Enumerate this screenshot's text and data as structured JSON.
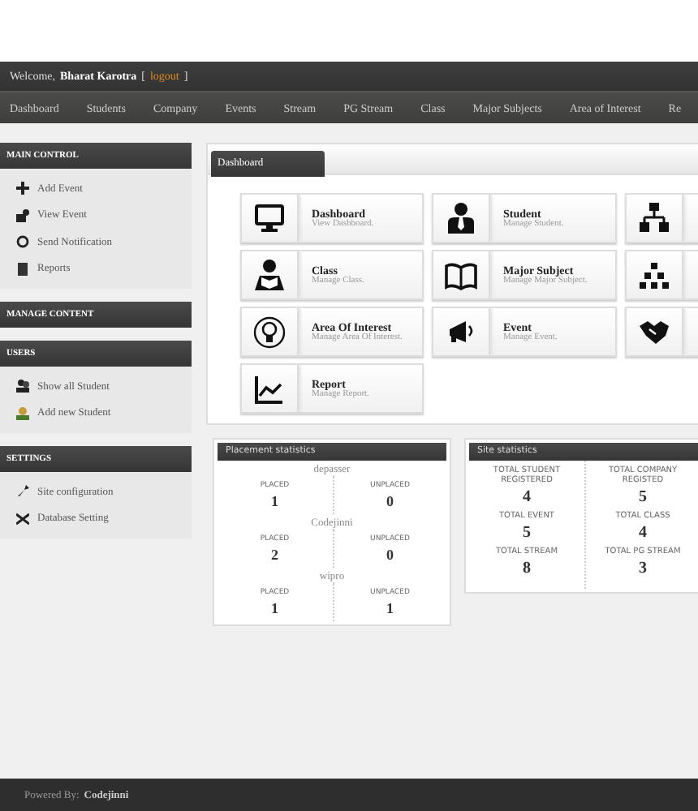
{
  "header": {
    "welcome": "Welcome,",
    "user": "Bharat Karotra",
    "logout_open": "[",
    "logout": "logout",
    "logout_close": "]"
  },
  "nav": [
    {
      "label": "Dashboard"
    },
    {
      "label": "Students"
    },
    {
      "label": "Company"
    },
    {
      "label": "Events"
    },
    {
      "label": "Stream"
    },
    {
      "label": "PG Stream"
    },
    {
      "label": "Class"
    },
    {
      "label": "Major Subjects"
    },
    {
      "label": "Area of Interest"
    },
    {
      "label": "Re"
    }
  ],
  "sidebar": [
    {
      "title": "MAIN CONTROL",
      "items": [
        {
          "label": "Add Event"
        },
        {
          "label": "View Event"
        },
        {
          "label": "Send Notification"
        },
        {
          "label": "Reports"
        }
      ]
    },
    {
      "title": "MANAGE CONTENT"
    },
    {
      "title": "USERS",
      "items": [
        {
          "label": "Show all Student"
        },
        {
          "label": "Add new Student"
        }
      ]
    },
    {
      "title": "SETTINGS",
      "items": [
        {
          "label": "Site configuration"
        },
        {
          "label": "Database Setting"
        }
      ]
    }
  ],
  "dashboard": {
    "title": "Dashboard",
    "tiles": [
      {
        "kind": "labeled",
        "title": "Dashboard",
        "subtitle": "View Dashboard."
      },
      {
        "kind": "labeled",
        "title": "Student",
        "subtitle": "Manage Student."
      },
      {
        "kind": "cut"
      },
      {
        "kind": "labeled",
        "title": "Class",
        "subtitle": "Manage Class."
      },
      {
        "kind": "labeled",
        "title": "Major Subject",
        "subtitle": "Manage Major Subject."
      },
      {
        "kind": "cut"
      },
      {
        "kind": "labeled",
        "title": "Area Of Interest",
        "subtitle": "Manage Area Of Interest."
      },
      {
        "kind": "labeled",
        "title": "Event",
        "subtitle": "Manage Event."
      },
      {
        "kind": "cut"
      },
      {
        "kind": "labeled",
        "title": "Report",
        "subtitle": "Manage Report."
      }
    ]
  },
  "placement": {
    "title": "Placement statistics",
    "companies": [
      {
        "name": "depasser",
        "placed_label": "PLACED",
        "placed": "1",
        "unplaced_label": "UNPLACED",
        "unplaced": "0"
      },
      {
        "name": "Codejinni",
        "placed_label": "PLACED",
        "placed": "2",
        "unplaced_label": "UNPLACED",
        "unplaced": "0"
      },
      {
        "name": "wipro",
        "placed_label": "PLACED",
        "placed": "1",
        "unplaced_label": "UNPLACED",
        "unplaced": "1"
      }
    ]
  },
  "site_stats": {
    "title": "Site statistics",
    "columns": [
      [
        {
          "label": "TOTAL STUDENT REGISTERED",
          "value": "4"
        },
        {
          "label": "TOTAL EVENT",
          "value": "5"
        },
        {
          "label": "TOTAL STREAM",
          "value": "8"
        }
      ],
      [
        {
          "label": "TOTAL COMPANY REGISTED",
          "value": "5"
        },
        {
          "label": "TOTAL CLASS",
          "value": "4"
        },
        {
          "label": "TOTAL PG STREAM",
          "value": "3"
        }
      ]
    ]
  },
  "footer": {
    "prefix": "Powered By:",
    "brand": "Codejinni"
  }
}
